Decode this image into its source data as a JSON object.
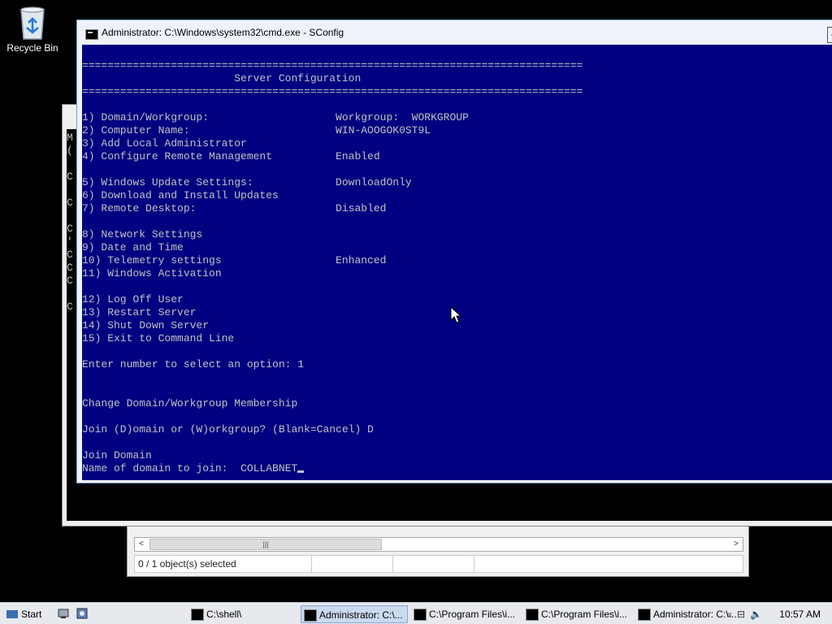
{
  "desktop": {
    "recycle_bin_label": "Recycle Bin"
  },
  "explorer_window": {
    "scroll_thumb_glyph": "|||",
    "scroll_left": "<",
    "scroll_right": ">",
    "status_selected": "0 / 1 object(s) selected"
  },
  "cmd_window": {
    "title": "Administrator: C:\\Windows\\system32\\cmd.exe - SConfig",
    "lines": [
      "===============================================================================",
      "                        Server Configuration",
      "===============================================================================",
      "1) Domain/Workgroup:                    Workgroup:  WORKGROUP",
      "2) Computer Name:                       WIN-AOOGOK0ST9L",
      "3) Add Local Administrator",
      "4) Configure Remote Management          Enabled",
      "5) Windows Update Settings:             DownloadOnly",
      "6) Download and Install Updates",
      "7) Remote Desktop:                      Disabled",
      "8) Network Settings",
      "9) Date and Time",
      "10) Telemetry settings                  Enhanced",
      "11) Windows Activation",
      "12) Log Off User",
      "13) Restart Server",
      "14) Shut Down Server",
      "15) Exit to Command Line",
      "Enter number to select an option: 1",
      "Change Domain/Workgroup Membership",
      "Join (D)omain or (W)orkgroup? (Blank=Cancel) D",
      "Join Domain",
      "Name of domain to join:  COLLABNET"
    ]
  },
  "background_cmd_fragments": [
    "M",
    "(",
    "C",
    "C",
    "C",
    "'",
    "C",
    "C",
    "C",
    "C"
  ],
  "taskbar": {
    "start_label": "Start",
    "buttons": [
      {
        "label": "C:\\shell\\",
        "active": false
      },
      {
        "label": "Administrator: C:\\...",
        "active": true
      },
      {
        "label": "C:\\Program Files\\i...",
        "active": false
      },
      {
        "label": "C:\\Program Files\\i...",
        "active": false
      },
      {
        "label": "Administrator: C:\\...",
        "active": false
      }
    ],
    "tray_icons": [
      "«",
      "⊟",
      "🔈"
    ],
    "clock": "10:57 AM"
  }
}
